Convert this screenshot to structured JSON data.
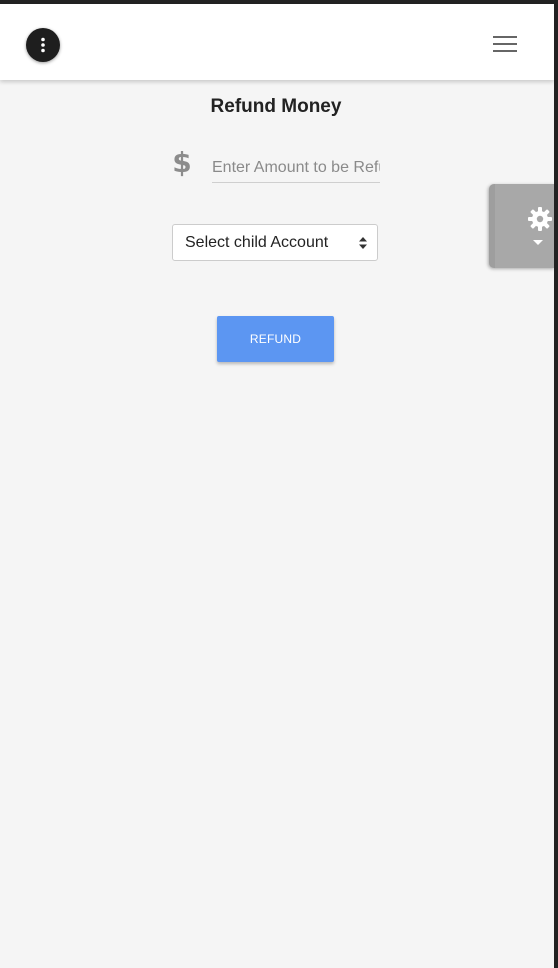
{
  "header": {
    "menu_icon": "more-vertical-icon",
    "hamburger_icon": "hamburger-menu-icon"
  },
  "page": {
    "title": "Refund Money"
  },
  "form": {
    "amount_icon": "dollar-icon",
    "amount_placeholder": "Enter Amount to be Refunded",
    "amount_value": "",
    "account_select_value": "Select child Account",
    "submit_label": "REFUND"
  },
  "settings_tab": {
    "icon": "gear-icon",
    "caret": "caret-down-icon"
  },
  "colors": {
    "background": "#f5f5f5",
    "navbar": "#ffffff",
    "primary_button": "#5c96f2",
    "settings_tab": "#a8a8a8"
  }
}
